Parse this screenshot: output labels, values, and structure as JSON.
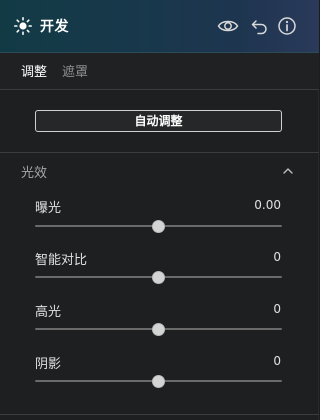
{
  "header": {
    "title": "开发",
    "icons": {
      "panel": "sun-icon",
      "visibility": "eye-icon",
      "reset": "undo-icon",
      "info": "info-icon"
    }
  },
  "tabs": [
    {
      "label": "调整",
      "active": true
    },
    {
      "label": "遮罩",
      "active": false
    }
  ],
  "auto_button": {
    "label": "自动调整"
  },
  "section": {
    "title": "光效",
    "expanded": true,
    "chevron_icon": "chevron-up-icon",
    "sliders": [
      {
        "label": "曝光",
        "value": "0.00",
        "position": 0.5
      },
      {
        "label": "智能对比",
        "value": "0",
        "position": 0.5
      },
      {
        "label": "高光",
        "value": "0",
        "position": 0.5
      },
      {
        "label": "阴影",
        "value": "0",
        "position": 0.5
      }
    ]
  },
  "colors": {
    "header_gradient_start": "#123a45",
    "header_gradient_end": "#2a3a5a",
    "panel_bg": "#1e1f20",
    "track": "#6a6a6a",
    "thumb": "#d4d4d4"
  }
}
